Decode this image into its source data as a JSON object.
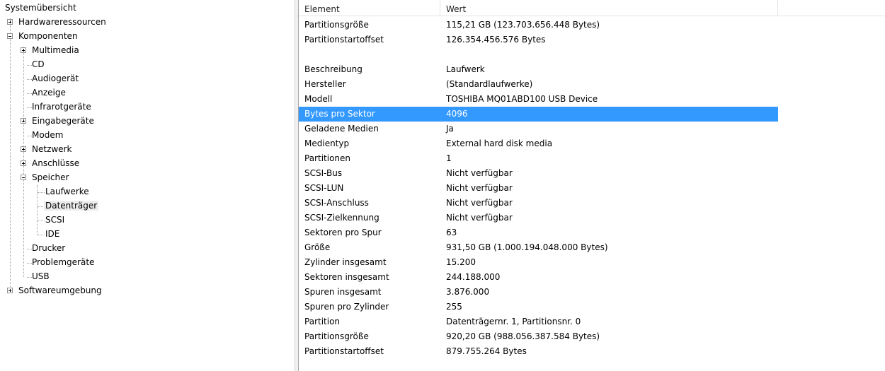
{
  "tree": {
    "root": "Systemübersicht",
    "hardware": "Hardwareressourcen",
    "komponenten": "Komponenten",
    "multimedia": "Multimedia",
    "cd": "CD",
    "audio": "Audiogerät",
    "anzeige": "Anzeige",
    "infrarot": "Infrarotgeräte",
    "eingabe": "Eingabegeräte",
    "modem": "Modem",
    "netzwerk": "Netzwerk",
    "anschluesse": "Anschlüsse",
    "speicher": "Speicher",
    "laufwerke": "Laufwerke",
    "datentraeger": "Datenträger",
    "scsi": "SCSI",
    "ide": "IDE",
    "drucker": "Drucker",
    "problem": "Problemgeräte",
    "usb": "USB",
    "software": "Softwareumgebung"
  },
  "list": {
    "headers": {
      "element": "Element",
      "wert": "Wert"
    },
    "rows": [
      {
        "element": "Partitionsgröße",
        "wert": "115,21 GB (123.703.656.448 Bytes)"
      },
      {
        "element": "Partitionstartoffset",
        "wert": "126.354.456.576 Bytes"
      },
      {
        "element": "",
        "wert": ""
      },
      {
        "element": "Beschreibung",
        "wert": "Laufwerk"
      },
      {
        "element": "Hersteller",
        "wert": "(Standardlaufwerke)"
      },
      {
        "element": "Modell",
        "wert": "TOSHIBA MQ01ABD100 USB Device"
      },
      {
        "element": "Bytes pro Sektor",
        "wert": "4096"
      },
      {
        "element": "Geladene Medien",
        "wert": "Ja"
      },
      {
        "element": "Medientyp",
        "wert": "External hard disk media"
      },
      {
        "element": "Partitionen",
        "wert": "1"
      },
      {
        "element": "SCSI-Bus",
        "wert": "Nicht verfügbar"
      },
      {
        "element": "SCSI-LUN",
        "wert": "Nicht verfügbar"
      },
      {
        "element": "SCSI-Anschluss",
        "wert": "Nicht verfügbar"
      },
      {
        "element": "SCSI-Zielkennung",
        "wert": "Nicht verfügbar"
      },
      {
        "element": "Sektoren pro Spur",
        "wert": "63"
      },
      {
        "element": "Größe",
        "wert": "931,50 GB (1.000.194.048.000 Bytes)"
      },
      {
        "element": "Zylinder insgesamt",
        "wert": "15.200"
      },
      {
        "element": "Sektoren insgesamt",
        "wert": "244.188.000"
      },
      {
        "element": "Spuren insgesamt",
        "wert": "3.876.000"
      },
      {
        "element": "Spuren pro Zylinder",
        "wert": "255"
      },
      {
        "element": "Partition",
        "wert": "Datenträgernr. 1, Partitionsnr. 0"
      },
      {
        "element": "Partitionsgröße",
        "wert": "920,20 GB (988.056.387.584 Bytes)"
      },
      {
        "element": "Partitionstartoffset",
        "wert": "879.755.264 Bytes"
      }
    ]
  },
  "colors": {
    "selection": "#3399ff"
  }
}
